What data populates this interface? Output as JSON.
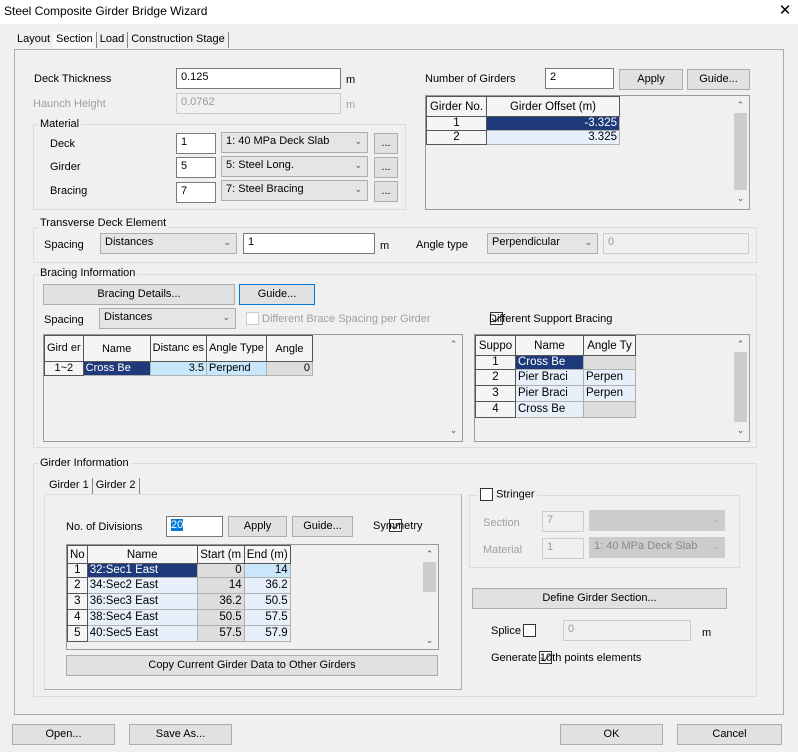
{
  "window": {
    "title": "Steel Composite Girder Bridge Wizard",
    "close_label": "✕"
  },
  "tabs": [
    {
      "label": "Layout",
      "active": false
    },
    {
      "label": "Section",
      "active": true
    },
    {
      "label": "Load",
      "active": false
    },
    {
      "label": "Construction Stage",
      "active": false
    }
  ],
  "section": {
    "deck_thickness": {
      "label": "Deck Thickness",
      "value": "0.125",
      "unit": "m"
    },
    "haunch_height": {
      "label": "Haunch Height",
      "value": "0.0762",
      "unit": "m"
    },
    "material": {
      "label": "Material",
      "rows": [
        {
          "label": "Deck",
          "id": "1",
          "selected": "1: 40 MPa Deck Slab",
          "browse": "..."
        },
        {
          "label": "Girder",
          "id": "5",
          "selected": "5: Steel Long.",
          "browse": "..."
        },
        {
          "label": "Bracing",
          "id": "7",
          "selected": "7: Steel Bracing",
          "browse": "..."
        }
      ]
    },
    "girders": {
      "label": "Number of Girders",
      "value": "2",
      "apply_label": "Apply",
      "guide_label": "Guide...",
      "columns": [
        "Girder No.",
        "Girder Offset (m)"
      ],
      "rows": [
        {
          "no": "1",
          "offset": "-3.325"
        },
        {
          "no": "2",
          "offset": "3.325"
        }
      ]
    },
    "transverse": {
      "label": "Transverse Deck Element",
      "spacing_label": "Spacing",
      "spacing_selected": "Distances",
      "spacing_value": "1",
      "unit": "m",
      "angle_type_label": "Angle type",
      "angle_type_selected": "Perpendicular",
      "angle_value": "0"
    },
    "bracing": {
      "label": "Bracing Information",
      "details_label": "Bracing Details...",
      "guide_label": "Guide...",
      "spacing_label": "Spacing",
      "spacing_selected": "Distances",
      "diff_brace_label": "Different Brace Spacing per Girder",
      "diff_brace_checked": false,
      "diff_support_label": "Different Support Bracing",
      "diff_support_checked": true,
      "columns": [
        "Gird er",
        "Name",
        "Distanc es",
        "Angle Type",
        "Angle"
      ],
      "rows": [
        {
          "girder": "1~2",
          "name": "Cross Be",
          "distance": "3.5",
          "angle_type": "Perpend",
          "angle": "0"
        }
      ],
      "support_columns": [
        "Suppo",
        "Name",
        "Angle Ty"
      ],
      "support_rows": [
        {
          "no": "1",
          "name": "Cross Be",
          "angle_type": ""
        },
        {
          "no": "2",
          "name": "Pier Braci",
          "angle_type": "Perpen"
        },
        {
          "no": "3",
          "name": "Pier Braci",
          "angle_type": "Perpen"
        },
        {
          "no": "4",
          "name": "Cross Be",
          "angle_type": ""
        }
      ]
    },
    "girder_info": {
      "label": "Girder Information",
      "tabs": [
        {
          "label": "Girder 1",
          "active": true
        },
        {
          "label": "Girder 2",
          "active": false
        }
      ],
      "divisions_label": "No. of Divisions",
      "divisions_value": "20",
      "apply_label": "Apply",
      "guide_label": "Guide...",
      "symmetry_label": "Symmetry",
      "symmetry_checked": true,
      "columns": [
        "No",
        "Name",
        "Start (m",
        "End (m)"
      ],
      "rows": [
        {
          "no": "1",
          "name": "32:Sec1 East",
          "start": "0",
          "end": "14"
        },
        {
          "no": "2",
          "name": "34:Sec2 East",
          "start": "14",
          "end": "36.2"
        },
        {
          "no": "3",
          "name": "36:Sec3 East",
          "start": "36.2",
          "end": "50.5"
        },
        {
          "no": "4",
          "name": "38:Sec4 East",
          "start": "50.5",
          "end": "57.5"
        },
        {
          "no": "5",
          "name": "40:Sec5 East",
          "start": "57.5",
          "end": "57.9"
        }
      ],
      "copy_label": "Copy Current Girder Data to Other Girders",
      "stringer": {
        "label": "Stringer",
        "checked": false,
        "section_label": "Section",
        "section_value": "7",
        "section_selected": "",
        "material_label": "Material",
        "material_value": "1",
        "material_selected": "1: 40 MPa Deck Slab"
      },
      "define_section_label": "Define Girder Section...",
      "splice_label": "Splice",
      "splice_checked": false,
      "splice_value": "0",
      "splice_unit": "m",
      "tenth_points_label": "Generate 10th points elements",
      "tenth_points_checked": true
    }
  },
  "footer": {
    "open_label": "Open...",
    "save_as_label": "Save As...",
    "ok_label": "OK",
    "cancel_label": "Cancel"
  },
  "icons": {
    "chevron": "﹀",
    "up": "^",
    "down": "v"
  }
}
